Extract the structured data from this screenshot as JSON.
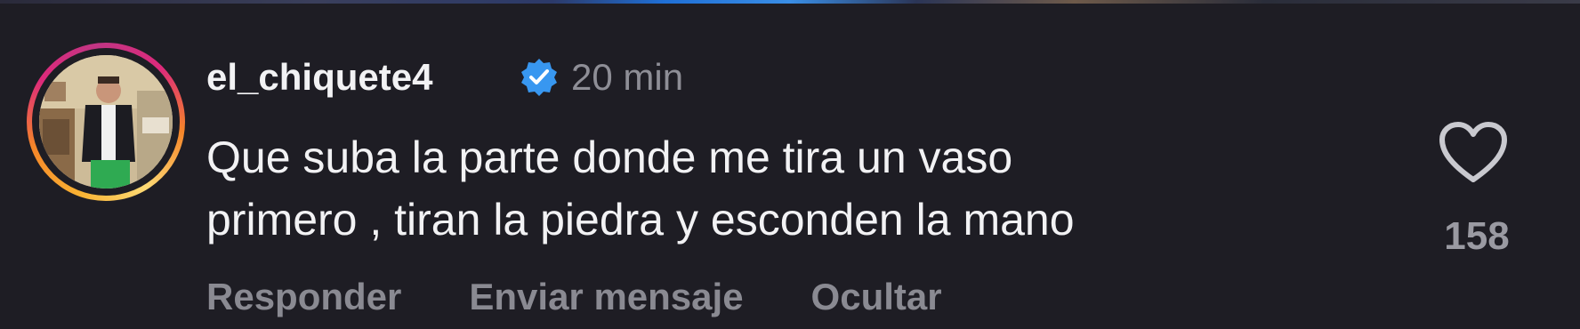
{
  "comment": {
    "username": "el_chiquete4",
    "verified": true,
    "time": "20 min",
    "text": "Que suba la parte donde me tira un vaso\nprimero , tiran la piedra y esconden la mano",
    "like_count": "158",
    "icons": {
      "verified": "verified-badge-icon",
      "like": "heart-outline-icon"
    }
  },
  "actions": {
    "reply": "Responder",
    "send_message": "Enviar mensaje",
    "hide": "Ocultar"
  },
  "colors": {
    "background": "#1e1d24",
    "text_primary": "#f2f2f4",
    "text_secondary": "#8e8e96",
    "verified_blue": "#3897f0"
  }
}
